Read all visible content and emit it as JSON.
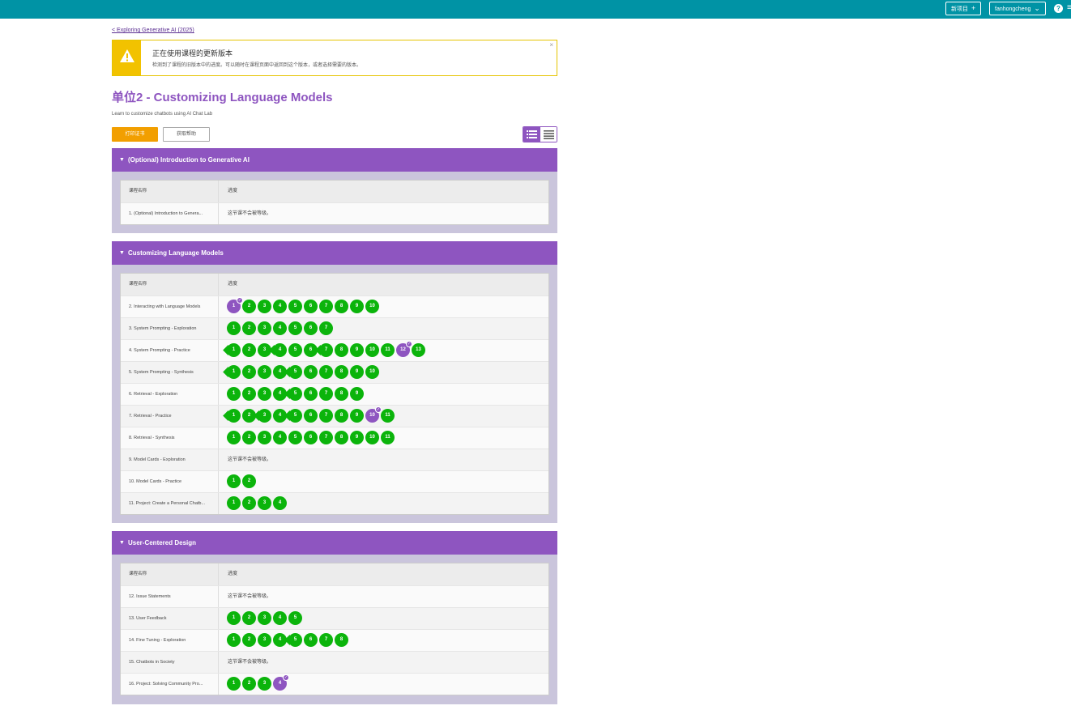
{
  "topbar": {
    "new_project_label": "新项目",
    "user_label": "fanhongcheng",
    "help_icon": "?",
    "menu_icon": "≡"
  },
  "back_link": "< Exploring Generative AI (2025)",
  "notice": {
    "title": "正在使用课程的更新版本",
    "body": "检测到了课程的旧版本中的进度。可以随时在课程页面中返回到这个版本，或者选择需要的版本。",
    "close": "×"
  },
  "unit": {
    "title": "单位2 - Customizing Language Models",
    "subtitle": "Learn to customize chatbots using AI Chat Lab",
    "print_label": "打印证书",
    "help_label": "获取帮助"
  },
  "colors": {
    "purple": "#8e55c0",
    "green": "#0bb40b",
    "teal": "#0093a5",
    "orange": "#f29f00"
  },
  "table_headers": {
    "lesson": "课程名称",
    "progress": "进度"
  },
  "not_graded_text": "这节课不会被等级。",
  "groups": [
    {
      "title": "(Optional) Introduction to Generative AI",
      "lessons": [
        {
          "name": "1. (Optional) Introduction to Genera...",
          "note": "这节课不会被等级。"
        }
      ]
    },
    {
      "title": "Customizing Language Models",
      "lessons": [
        {
          "name": "2. Interacting with Language Models"
        },
        {
          "name": "3. System Prompting - Exploration"
        },
        {
          "name": "4. System Prompting - Practice"
        },
        {
          "name": "5. System Prompting - Synthesis"
        },
        {
          "name": "6. Retrieval - Exploration"
        },
        {
          "name": "7. Retrieval - Practice"
        },
        {
          "name": "8. Retrieval - Synthesis"
        },
        {
          "name": "9. Model Cards - Exploration",
          "note": "这节课不会被等级。"
        },
        {
          "name": "10. Model Cards - Practice"
        },
        {
          "name": "11. Project: Create a Personal Chatb..."
        }
      ]
    },
    {
      "title": "User-Centered Design",
      "lessons": [
        {
          "name": "12. Issue Statements",
          "note": "这节课不会被等级。"
        },
        {
          "name": "13. User Feedback"
        },
        {
          "name": "14. Fine Tuning - Exploration"
        },
        {
          "name": "15. Chatbots in Society",
          "note": "这节课不会被等级。"
        },
        {
          "name": "16. Project: Solving Community Pro..."
        }
      ]
    }
  ],
  "progress": {
    "l2": {
      "count": 10,
      "purple": [
        1
      ],
      "diamond": [],
      "check": [
        1
      ]
    },
    "l3": {
      "count": 7,
      "purple": [],
      "diamond": [],
      "check": []
    },
    "l4": {
      "count": 13,
      "purple": [
        12
      ],
      "diamond": [
        1,
        4,
        7
      ],
      "check": [
        12
      ]
    },
    "l5": {
      "count": 10,
      "purple": [],
      "diamond": [
        1,
        5
      ],
      "check": []
    },
    "l6": {
      "count": 9,
      "purple": [],
      "diamond": [
        5
      ],
      "check": []
    },
    "l7": {
      "count": 11,
      "purple": [
        10
      ],
      "diamond": [
        1,
        3,
        5
      ],
      "check": [
        10
      ]
    },
    "l8": {
      "count": 11,
      "purple": [],
      "diamond": [],
      "check": []
    },
    "l10": {
      "count": 2,
      "purple": [],
      "diamond": [],
      "check": []
    },
    "l11": {
      "count": 4,
      "purple": [],
      "diamond": [],
      "check": []
    },
    "l13": {
      "count": 5,
      "purple": [],
      "diamond": [],
      "check": []
    },
    "l14": {
      "count": 8,
      "purple": [],
      "diamond": [
        5
      ],
      "check": []
    },
    "l16": {
      "count": 4,
      "purple": [
        4
      ],
      "diamond": [],
      "check": [
        4
      ]
    }
  }
}
